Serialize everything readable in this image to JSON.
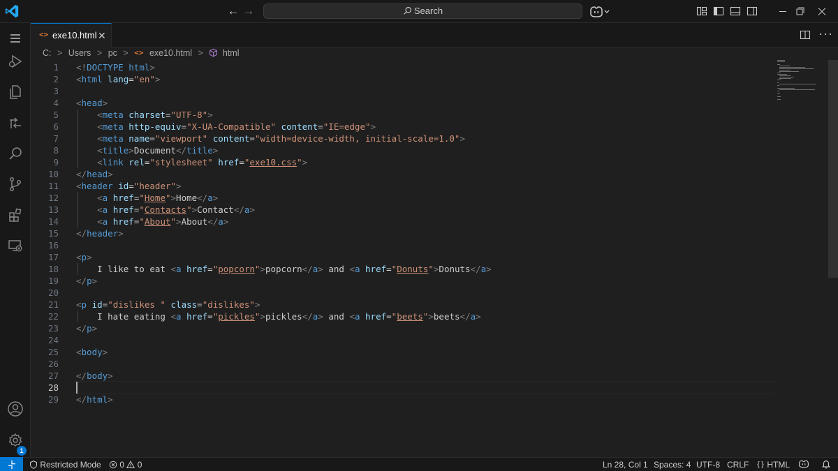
{
  "titlebar": {
    "search_placeholder": "Search"
  },
  "tabs": [
    {
      "label": "exe10.html",
      "icon": "html-file-icon",
      "close": "✕",
      "active": true
    }
  ],
  "breadcrumb": {
    "items": [
      "C:",
      "Users",
      "pc",
      "exe10.html",
      "html"
    ]
  },
  "editor": {
    "cursor_line": 28,
    "lines": [
      {
        "n": "1"
      },
      {
        "n": "2"
      },
      {
        "n": "3"
      },
      {
        "n": "4"
      },
      {
        "n": "5"
      },
      {
        "n": "6"
      },
      {
        "n": "7"
      },
      {
        "n": "8"
      },
      {
        "n": "9"
      },
      {
        "n": "10"
      },
      {
        "n": "11"
      },
      {
        "n": "12"
      },
      {
        "n": "13"
      },
      {
        "n": "14"
      },
      {
        "n": "15"
      },
      {
        "n": "16"
      },
      {
        "n": "17"
      },
      {
        "n": "18"
      },
      {
        "n": "19"
      },
      {
        "n": "20"
      },
      {
        "n": "21"
      },
      {
        "n": "22"
      },
      {
        "n": "23"
      },
      {
        "n": "24"
      },
      {
        "n": "25"
      },
      {
        "n": "26"
      },
      {
        "n": "27"
      },
      {
        "n": "28"
      },
      {
        "n": "29"
      }
    ],
    "code": [
      "<!DOCTYPE html>",
      "<html lang=\"en\">",
      "",
      "<head>",
      "    <meta charset=\"UTF-8\">",
      "    <meta http-equiv=\"X-UA-Compatible\" content=\"IE=edge\">",
      "    <meta name=\"viewport\" content=\"width=device-width, initial-scale=1.0\">",
      "    <title>Document</title>",
      "    <link rel=\"stylesheet\" href=\"exe10.css\">",
      "</head>",
      "<header id=\"header\">",
      "    <a href=\"Home\">Home</a>",
      "    <a href=\"Contacts\">Contact</a>",
      "    <a href=\"About\">About</a>",
      "</header>",
      "",
      "<p>",
      "    I like to eat <a href=\"popcorn\">popcorn</a> and <a href=\"Donuts\">Donuts</a>",
      "</p>",
      "",
      "<p id=\"dislikes \" class=\"dislikes\">",
      "    I hate eating <a href=\"pickles\">pickles</a> and <a href=\"beets\">beets</a>",
      "</p>",
      "",
      "<body>",
      "",
      "</body>",
      "",
      "</html>"
    ]
  },
  "statusbar": {
    "restricted_mode": "Restricted Mode",
    "errors": "0",
    "warnings": "0",
    "position": "Ln 28, Col 1",
    "spaces": "Spaces: 4",
    "encoding": "UTF-8",
    "eol": "CRLF",
    "language": "HTML"
  },
  "accounts_badge": "1",
  "colors": {
    "accent": "#0078d4",
    "tag": "#569cd6",
    "attribute": "#9cdcfe",
    "string": "#ce9178",
    "bracket": "#808080",
    "file_icon": "#e37933"
  }
}
